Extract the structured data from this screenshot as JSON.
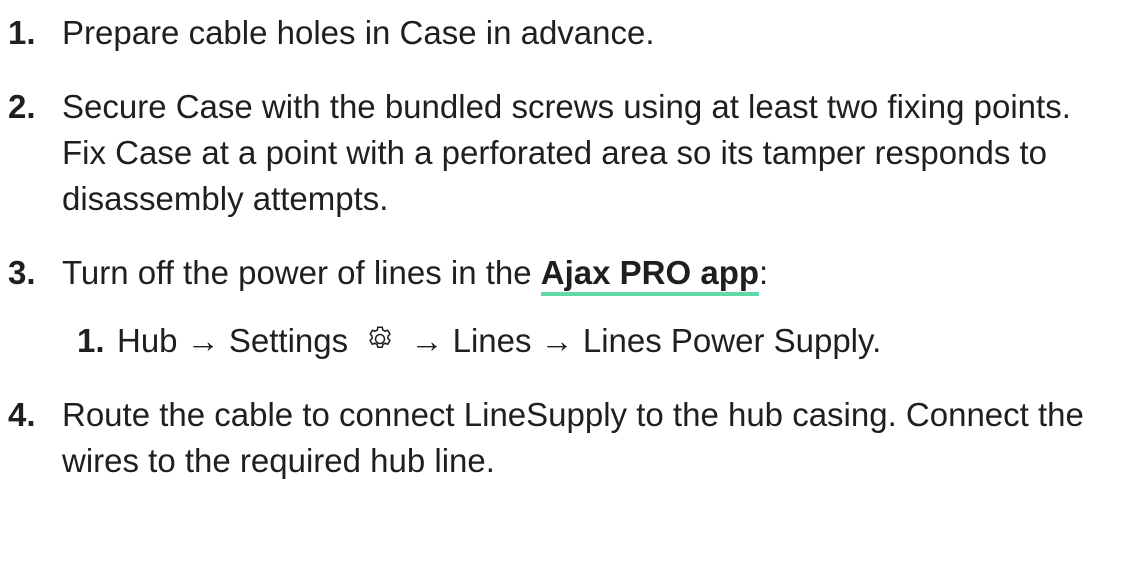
{
  "steps": [
    {
      "number": "1.",
      "text": "Prepare cable holes in Case in advance."
    },
    {
      "number": "2.",
      "text": "Secure Case with the bundled screws using at least two fixing points. Fix Case at a point with a perforated area so its tamper responds to disassembly attempts."
    },
    {
      "number": "3.",
      "text_before": "Turn off the power of lines in the ",
      "link_text": "Ajax PRO app",
      "text_after": ":",
      "substeps": [
        {
          "number": "1.",
          "before_icon": "Hub → Settings ",
          "icon": "gear-icon",
          "after_icon": " → Lines → Lines Power Supply."
        }
      ]
    },
    {
      "number": "4.",
      "text": "Route the cable to connect LineSupply to the hub casing. Connect the wires to the required hub line."
    }
  ],
  "colors": {
    "text": "#1f1f1f",
    "link_underline": "#5fd9a8"
  }
}
